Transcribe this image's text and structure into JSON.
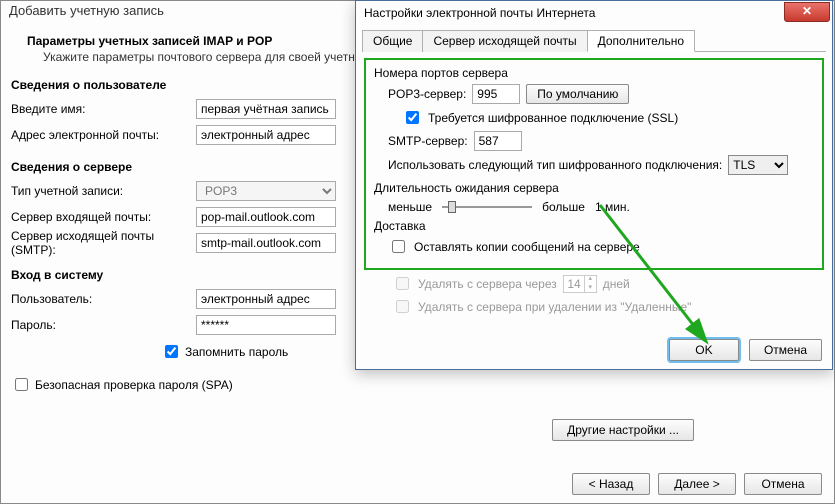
{
  "parent": {
    "title": "Добавить учетную запись",
    "heading": "Параметры учетных записей IMAP и POP",
    "subheading": "Укажите параметры почтового сервера для своей учетной записи.",
    "user_info_label": "Сведения о пользователе",
    "name_label": "Введите имя:",
    "name_value": "первая учётная запись",
    "email_label": "Адрес электронной почты:",
    "email_value": "электронный адрес",
    "server_info_label": "Сведения о сервере",
    "account_type_label": "Тип учетной записи:",
    "account_type_value": "POP3",
    "incoming_label": "Сервер входящей почты:",
    "incoming_value": "pop-mail.outlook.com",
    "outgoing_label": "Сервер исходящей почты (SMTP):",
    "outgoing_value": "smtp-mail.outlook.com",
    "login_label": "Вход в систему",
    "user_label": "Пользователь:",
    "user_value": "электронный адрес",
    "password_label": "Пароль:",
    "password_value": "******",
    "remember_label": "Запомнить пароль",
    "spa_label": "Безопасная проверка пароля (SPA)",
    "other_settings": "Другие настройки ...",
    "back": "< Назад",
    "next": "Далее >",
    "cancel": "Отмена"
  },
  "dialog": {
    "title": "Настройки электронной почты Интернета",
    "tabs": {
      "general": "Общие",
      "outgoing": "Сервер исходящей почты",
      "advanced": "Дополнительно"
    },
    "ports_group": "Номера портов сервера",
    "pop3_label": "POP3-сервер:",
    "pop3_value": "995",
    "defaults_btn": "По умолчанию",
    "ssl_label": "Требуется шифрованное подключение (SSL)",
    "smtp_label": "SMTP-сервер:",
    "smtp_value": "587",
    "enc_label": "Использовать следующий тип шифрованного подключения:",
    "enc_value": "TLS",
    "timeout_group": "Длительность ожидания сервера",
    "timeout_less": "меньше",
    "timeout_more": "больше",
    "timeout_value": "1 мин.",
    "delivery_group": "Доставка",
    "leave_copy": "Оставлять копии сообщений на сервере",
    "delete_after": "Удалять с сервера через",
    "delete_after_days": "14",
    "delete_after_unit": "дней",
    "delete_deleted": "Удалять с сервера при удалении из \"Удаленные\"",
    "ok": "OK",
    "cancel": "Отмена"
  }
}
